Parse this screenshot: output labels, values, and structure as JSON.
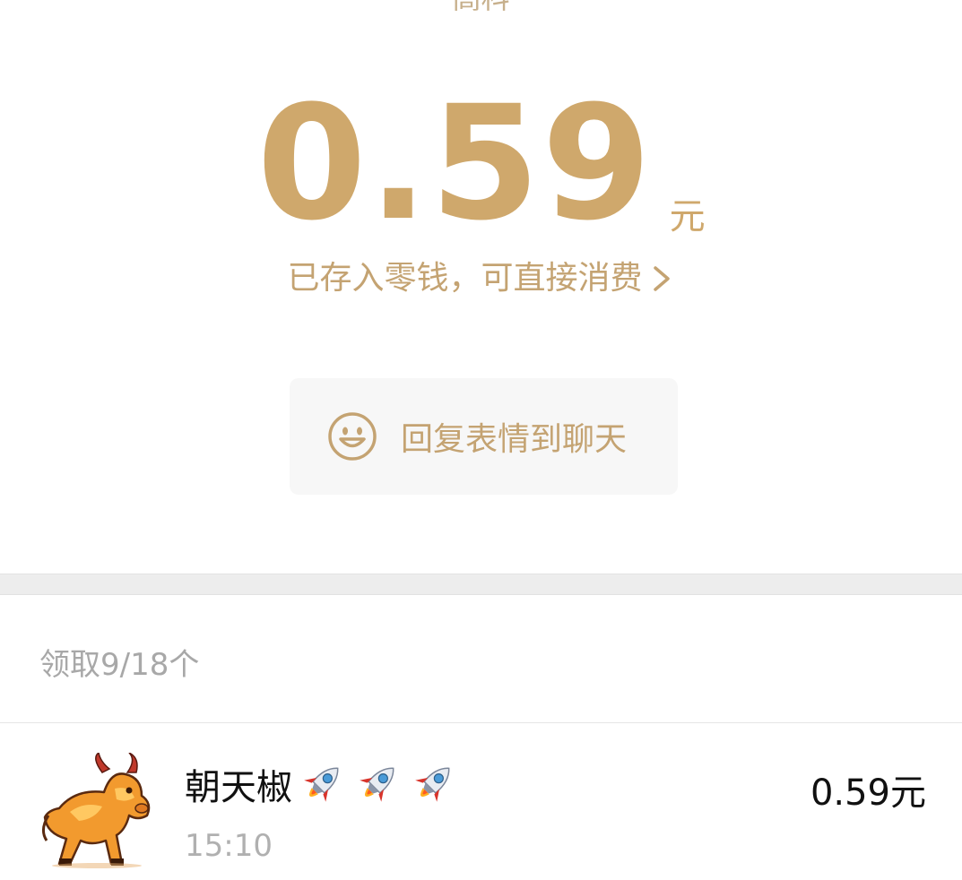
{
  "header": {
    "cut_text": "高科"
  },
  "amount": {
    "value": "0.59",
    "unit": "元"
  },
  "wallet_link": {
    "label": "已存入零钱，可直接消费"
  },
  "reply_button": {
    "label": "回复表情到聊天",
    "icon": "smiley-icon"
  },
  "claim_status": {
    "label": "领取9/18个"
  },
  "records": [
    {
      "name": "朝天椒",
      "emoji_icons": [
        "rocket-icon",
        "rocket-icon",
        "rocket-icon"
      ],
      "time": "15:10",
      "amount": "0.59元"
    }
  ],
  "colors": {
    "gold": "#cfa86c",
    "gold_text": "#c4a372",
    "gray_text": "#a8a8a8",
    "button_bg": "#f7f7f7"
  }
}
